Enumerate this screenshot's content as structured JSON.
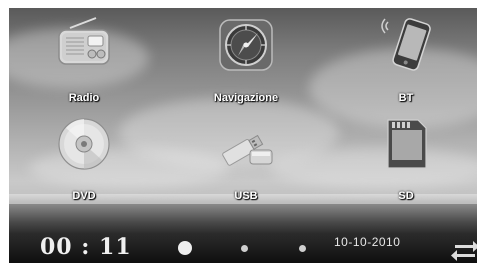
{
  "apps": {
    "radio": {
      "label": "Radio",
      "icon": "radio-icon"
    },
    "navigation": {
      "label": "Navigazione",
      "icon": "clock-compass-icon"
    },
    "bt": {
      "label": "BT",
      "icon": "phone-icon"
    },
    "dvd": {
      "label": "DVD",
      "icon": "disc-icon"
    },
    "usb": {
      "label": "USB",
      "icon": "usb-drive-icon"
    },
    "sd": {
      "label": "SD",
      "icon": "sd-card-icon"
    }
  },
  "status": {
    "time": "00 : 11",
    "date": "10-10-2010",
    "swap_icon": "swap-arrows-icon"
  },
  "pager": {
    "pages": 3,
    "current": 1
  }
}
